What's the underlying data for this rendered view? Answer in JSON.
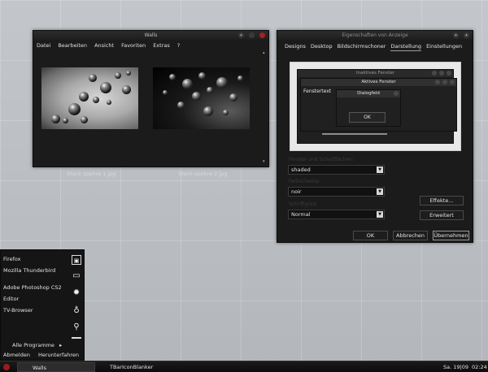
{
  "walls_window": {
    "title": "Walls",
    "menu": [
      "Datei",
      "Bearbeiten",
      "Ansicht",
      "Favoriten",
      "Extras",
      "?"
    ],
    "items": [
      {
        "caption": "black spehre 1.jpg"
      },
      {
        "caption": "black spehre 2.jpg"
      }
    ]
  },
  "props_window": {
    "title": "Eigenschaften von Anzeige",
    "tabs": [
      "Designs",
      "Desktop",
      "Bildschirmschoner",
      "Darstellung",
      "Einstellungen"
    ],
    "active_tab": "Darstellung",
    "preview": {
      "inactive_title": "Inaktives Fenster",
      "active_title": "Aktives Fenster",
      "window_text": "Fenstertext",
      "dialog_title": "Dialogfeld",
      "ok_label": "OK"
    },
    "fields": [
      {
        "label": "Fenster und Schaltflächen:",
        "value": "shaded"
      },
      {
        "label": "Farbschema:",
        "value": "noir"
      },
      {
        "label": "Schriftgrad:",
        "value": "Normal"
      }
    ],
    "effects_button": "Effekte...",
    "advanced_button": "Erweitert",
    "ok_button": "OK",
    "cancel_button": "Abbrechen",
    "apply_button": "Übernehmen"
  },
  "start_menu": {
    "items": [
      "Firefox",
      "Mozilla Thunderbird",
      "Adobe Photoshop CS2",
      "Editor",
      "TV-Browser"
    ],
    "all_programs": "Alle Programme",
    "logoff": "Abmelden",
    "shutdown": "Herunterfahren"
  },
  "taskbar": {
    "tasks": [
      "Walls",
      "TBarIconBlanker"
    ],
    "date": "Sa. 19|09",
    "time": "02:24"
  },
  "colors": {
    "window_bg": "#1b1b1b",
    "accent_red": "#a32222",
    "desktop_bg": "#b9bcc1"
  }
}
